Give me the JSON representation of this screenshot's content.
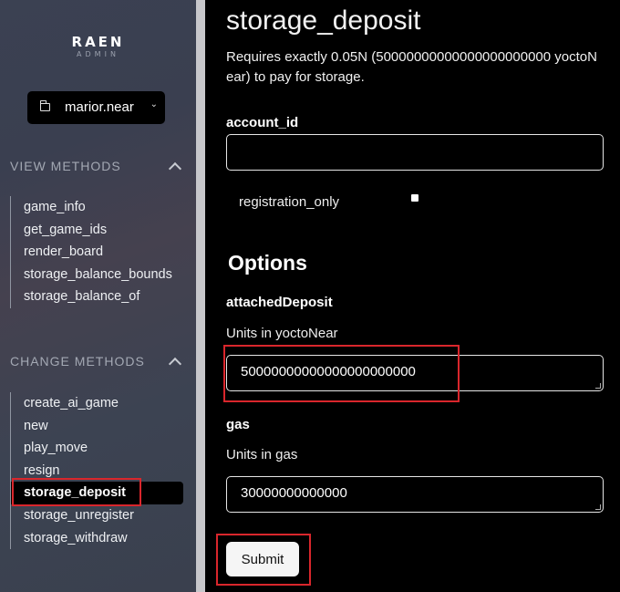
{
  "logo": {
    "main": "RAEN",
    "sub": "ADMIN"
  },
  "account": {
    "name": "marior.near"
  },
  "view_methods": {
    "heading": "VIEW METHODS",
    "items": [
      "game_info",
      "get_game_ids",
      "render_board",
      "storage_balance_bounds",
      "storage_balance_of"
    ]
  },
  "change_methods": {
    "heading": "CHANGE METHODS",
    "items": [
      "create_ai_game",
      "new",
      "play_move",
      "resign",
      "storage_deposit",
      "storage_unregister",
      "storage_withdraw"
    ],
    "active": "storage_deposit"
  },
  "form": {
    "title": "storage_deposit",
    "description": "Requires exactly 0.05N (50000000000000000000000 yoctoNear) to pay for storage.",
    "account_id_label": "account_id",
    "account_id_value": "",
    "registration_only_label": "registration_only",
    "options_title": "Options",
    "attached_deposit_label": "attachedDeposit",
    "attached_deposit_hint": "Units in yoctoNear",
    "attached_deposit_value": "50000000000000000000000",
    "gas_label": "gas",
    "gas_hint": "Units in gas",
    "gas_value": "30000000000000",
    "submit_label": "Submit"
  },
  "colors": {
    "highlight": "#d9262c",
    "sidebar": "#3b4152",
    "main_bg": "#000000"
  },
  "icons": {
    "account": "folder-icon",
    "account_toggle": "chevron-down-icon",
    "collapse": "chevron-up-icon"
  }
}
